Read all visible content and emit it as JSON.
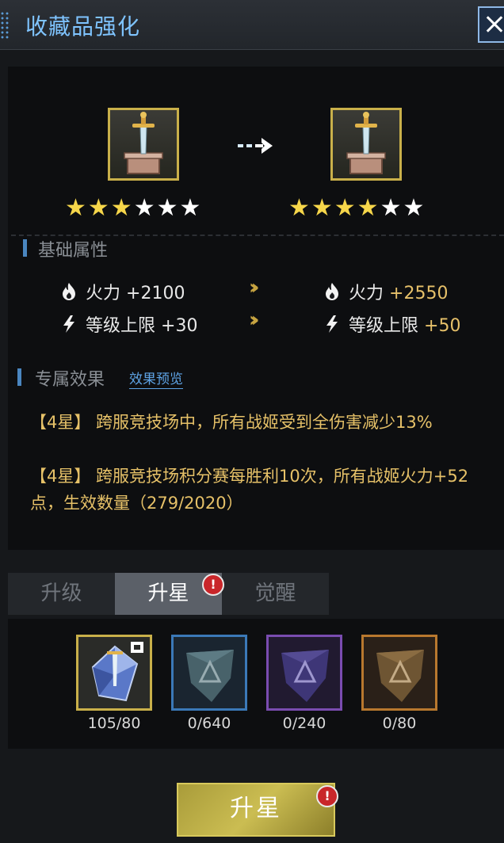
{
  "header": {
    "title": "收藏品强化"
  },
  "upgrade": {
    "current_stars": {
      "filled": 3,
      "total": 6,
      "text_filled": "★★★",
      "text_empty": "★★★"
    },
    "next_stars": {
      "filled": 4,
      "total": 6,
      "text_filled": "★★★★",
      "text_empty": "★★"
    }
  },
  "base_attributes": {
    "label": "基础属性",
    "rows": [
      {
        "icon": "flame-icon",
        "name": "火力",
        "current": "+2100",
        "next": "+2550"
      },
      {
        "icon": "lightning-icon",
        "name": "等级上限",
        "current": "+30",
        "next": "+50"
      }
    ]
  },
  "exclusive_effect": {
    "label": "专属效果",
    "preview_link": "效果预览",
    "effects": [
      "【4星】 跨服竞技场中，所有战姬受到全伤害减少13%",
      "【4星】 跨服竞技场积分赛每胜利10次，所有战姬火力+52点，生效数量（279/2020）"
    ]
  },
  "tabs": [
    {
      "label": "升级",
      "active": false
    },
    {
      "label": "升星",
      "active": true,
      "badge": "!"
    },
    {
      "label": "觉醒",
      "active": false
    }
  ],
  "materials": [
    {
      "name": "sword-shard",
      "count": "105/80",
      "frame_color": "#c9b04a"
    },
    {
      "name": "teal-stone",
      "count": "0/640",
      "frame_color": "#3b79b8"
    },
    {
      "name": "purple-stone",
      "count": "0/240",
      "frame_color": "#7a4cb0"
    },
    {
      "name": "orange-stone",
      "count": "0/80",
      "frame_color": "#b8782e"
    }
  ],
  "action_button": {
    "label": "升星",
    "badge": "!"
  },
  "colors": {
    "accent_blue": "#7fc4ff",
    "gold": "#e6c168",
    "star_gold": "#f6d64a",
    "alert_red": "#c9262a"
  }
}
